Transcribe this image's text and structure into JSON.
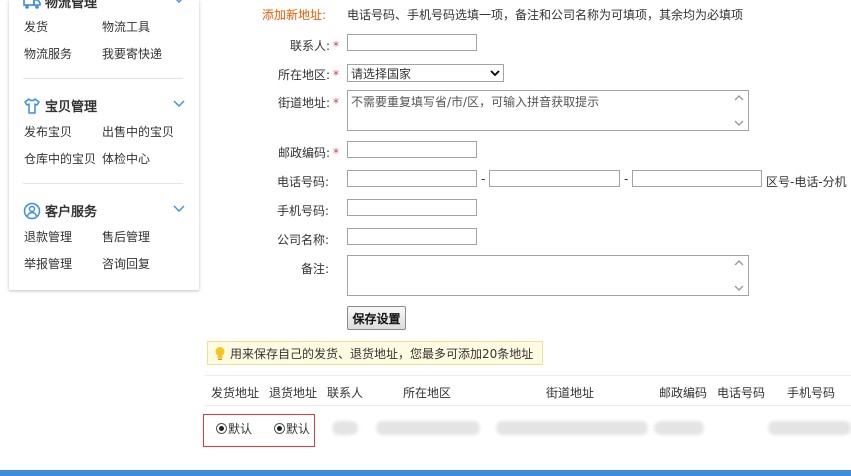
{
  "sidebar": {
    "logistics": {
      "title": "物流管理",
      "links": [
        "发货",
        "物流工具",
        "物流服务",
        "我要寄快递"
      ]
    },
    "items": {
      "title": "宝贝管理",
      "links": [
        "发布宝贝",
        "出售中的宝贝",
        "仓库中的宝贝",
        "体检中心"
      ]
    },
    "service": {
      "title": "客户服务",
      "links": [
        "退款管理",
        "售后管理",
        "举报管理",
        "咨询回复"
      ]
    }
  },
  "form": {
    "header_label": "添加新地址:",
    "notice": "电话号码、手机号码选填一项，备注和公司名称为可填项，其余均为必填项",
    "contact_label": "联系人:",
    "region_label": "所在地区:",
    "region_selected": "请选择国家",
    "street_label": "街道地址:",
    "street_placeholder": "不需要重复填写省/市/区，可输入拼音获取提示",
    "postcode_label": "邮政编码:",
    "phone_label": "电话号码:",
    "phone_hint": "区号-电话-分机",
    "mobile_label": "手机号码:",
    "company_label": "公司名称:",
    "remark_label": "备注:",
    "required_mark": "*",
    "dash": "-",
    "save_button": "保存设置"
  },
  "tip": "用来保存自己的发货、退货地址，您最多可添加20条地址",
  "table": {
    "headers": [
      "发货地址",
      "退货地址",
      "联系人",
      "所在地区",
      "街道地址",
      "邮政编码",
      "电话号码",
      "手机号码"
    ],
    "row": {
      "ship_default": "默认",
      "return_default": "默认"
    }
  },
  "colors": {
    "accent": "#f05a00",
    "required": "#e4393c",
    "icon_blue": "#3a8ee6",
    "tip_bg": "#fffbe0"
  }
}
